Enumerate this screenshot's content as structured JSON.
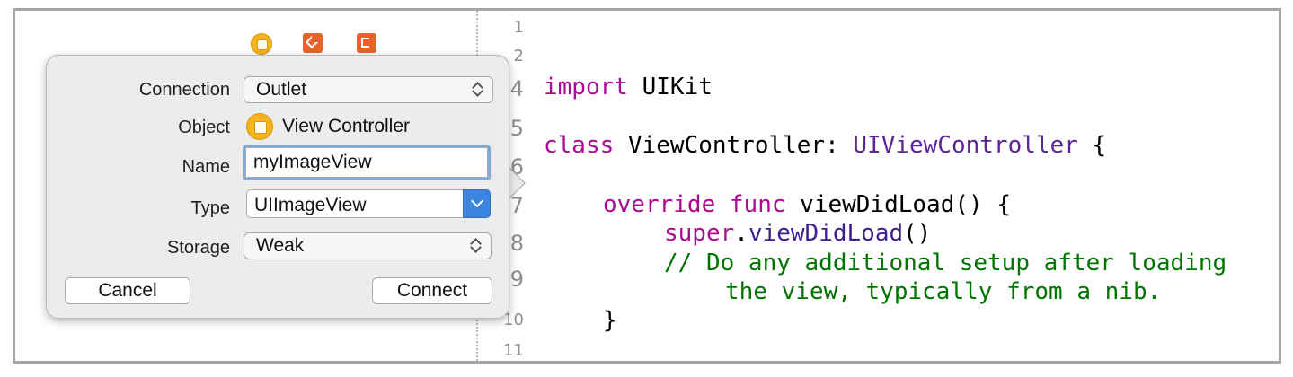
{
  "popover": {
    "connection": {
      "label": "Connection",
      "value": "Outlet"
    },
    "object": {
      "label": "Object",
      "value": "View Controller"
    },
    "name": {
      "label": "Name",
      "value": "myImageView"
    },
    "type": {
      "label": "Type",
      "value": "UIImageView"
    },
    "storage": {
      "label": "Storage",
      "value": "Weak"
    },
    "buttons": {
      "cancel": "Cancel",
      "connect": "Connect"
    }
  },
  "scene_dock": {
    "icons": [
      "view-controller-icon",
      "first-responder-icon",
      "exit-icon"
    ]
  },
  "editor": {
    "line_numbers": [
      "1",
      "2",
      "4",
      "5",
      "6",
      "7",
      "8",
      "9",
      "10",
      "11"
    ],
    "lines": [
      {
        "parts": [
          {
            "text": "import",
            "style": "keyword"
          },
          {
            "text": " UIKit",
            "style": "plain"
          }
        ]
      },
      {
        "parts": [
          {
            "text": "class",
            "style": "keyword"
          },
          {
            "text": " ViewController: ",
            "style": "plain"
          },
          {
            "text": "UIViewController",
            "style": "type"
          },
          {
            "text": " {",
            "style": "plain"
          }
        ]
      },
      {
        "parts": [
          {
            "text": "override",
            "style": "keyword"
          },
          {
            "text": " ",
            "style": "plain"
          },
          {
            "text": "func",
            "style": "keyword"
          },
          {
            "text": " viewDidLoad() {",
            "style": "plain"
          }
        ]
      },
      {
        "parts": [
          {
            "text": "super",
            "style": "keyword"
          },
          {
            "text": ".",
            "style": "plain"
          },
          {
            "text": "viewDidLoad",
            "style": "function"
          },
          {
            "text": "()",
            "style": "plain"
          }
        ]
      },
      {
        "parts": [
          {
            "text": "// Do any additional setup after loading",
            "style": "comment"
          }
        ]
      },
      {
        "parts": [
          {
            "text": "the view, typically from a nib.",
            "style": "comment"
          }
        ]
      },
      {
        "parts": [
          {
            "text": "}",
            "style": "plain"
          }
        ]
      }
    ]
  },
  "colors": {
    "keyword": "#aa0d91",
    "type": "#5c2699",
    "function": "#3f1f8f",
    "comment": "#007400",
    "accent": "#3b84e0",
    "focus_ring": "#7ea9dc"
  }
}
